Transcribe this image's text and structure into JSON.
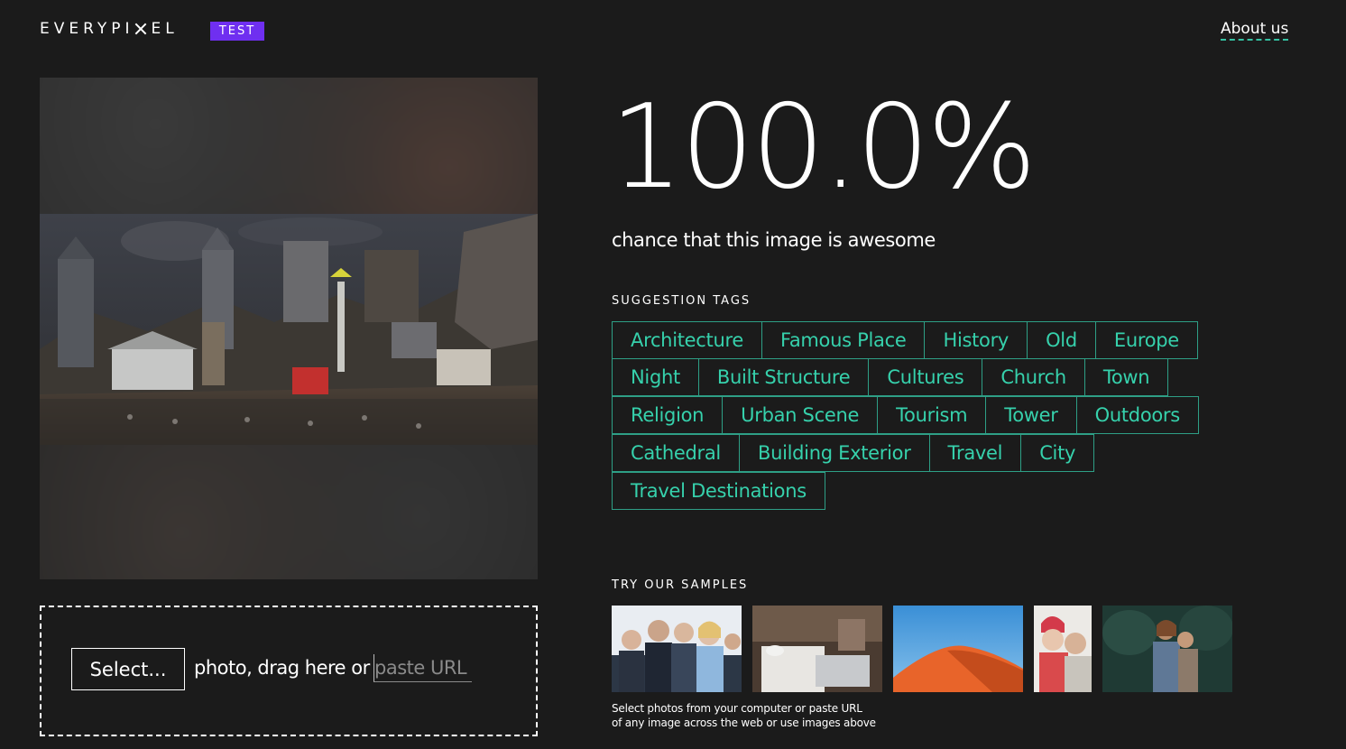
{
  "header": {
    "logo_part1": "EVERYPI",
    "logo_part2": "EL",
    "badge": "TEST",
    "about_link": "About us"
  },
  "result": {
    "score": "100.0%",
    "subtitle": "chance that this image is awesome"
  },
  "tags_section": {
    "title": "SUGGESTION TAGS",
    "rows": [
      [
        "Architecture",
        "Famous Place",
        "History",
        "Old",
        "Europe"
      ],
      [
        "Night",
        "Built Structure",
        "Cultures",
        "Church",
        "Town"
      ],
      [
        "Religion",
        "Urban Scene",
        "Tourism",
        "Tower",
        "Outdoors"
      ],
      [
        "Cathedral",
        "Building Exterior",
        "Travel",
        "City"
      ],
      [
        "Travel Destinations"
      ]
    ]
  },
  "upload": {
    "select_label": "Select...",
    "text": "photo, drag here or",
    "url_placeholder": "paste URL"
  },
  "samples_section": {
    "title": "TRY OUR SAMPLES",
    "hint_line1": "Select photos from your computer or paste URL",
    "hint_line2": "of any image across the web or use images above"
  },
  "colors": {
    "background": "#1b1b1b",
    "accent_purple": "#6f2ff0",
    "tag_text": "#36d1ac",
    "tag_border": "#2e9f86"
  }
}
